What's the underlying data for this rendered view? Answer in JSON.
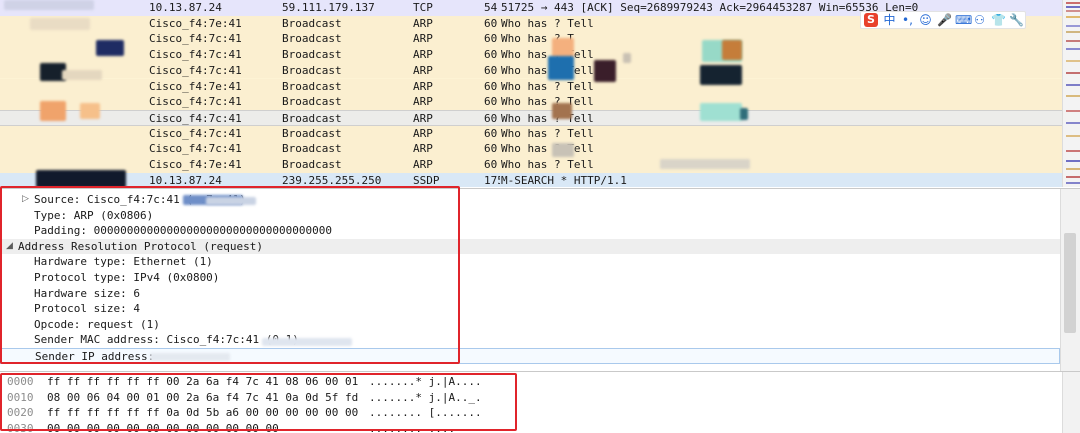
{
  "packets": [
    {
      "no": "",
      "source": "10.13.87.24",
      "destination": "59.111.179.137",
      "protocol": "TCP",
      "length": "54",
      "info": "51725 → 443 [ACK] Seq=2689979243 Ack=2964453287 Win=65536 Len=0",
      "kind": "tcp"
    },
    {
      "no": "",
      "source": "Cisco_f4:7e:41",
      "destination": "Broadcast",
      "protocol": "ARP",
      "length": "60",
      "info": "Who has            ? Tell",
      "kind": "arp"
    },
    {
      "no": "",
      "source": "Cisco_f4:7c:41",
      "destination": "Broadcast",
      "protocol": "ARP",
      "length": "60",
      "info": "Who has            ? T",
      "kind": "arp"
    },
    {
      "no": "",
      "source": "Cisco_f4:7c:41",
      "destination": "Broadcast",
      "protocol": "ARP",
      "length": "60",
      "info": "Who has            ? Tell",
      "kind": "arp"
    },
    {
      "no": "",
      "source": "Cisco_f4:7c:41",
      "destination": "Broadcast",
      "protocol": "ARP",
      "length": "60",
      "info": "Who has            ? Tell",
      "kind": "arp"
    },
    {
      "no": "",
      "source": "Cisco_f4:7e:41",
      "destination": "Broadcast",
      "protocol": "ARP",
      "length": "60",
      "info": "Who has            ? Tell",
      "kind": "arp"
    },
    {
      "no": "",
      "source": "Cisco_f4:7c:41",
      "destination": "Broadcast",
      "protocol": "ARP",
      "length": "60",
      "info": "Who has            ? Tell",
      "kind": "arp"
    },
    {
      "no": "",
      "source": "Cisco_f4:7c:41",
      "destination": "Broadcast",
      "protocol": "ARP",
      "length": "60",
      "info": "Who has            ? Tell",
      "kind": "selected"
    },
    {
      "no": "",
      "source": "Cisco_f4:7c:41",
      "destination": "Broadcast",
      "protocol": "ARP",
      "length": "60",
      "info": "Who has            ? Tell",
      "kind": "arp"
    },
    {
      "no": "",
      "source": "Cisco_f4:7c:41",
      "destination": "Broadcast",
      "protocol": "ARP",
      "length": "60",
      "info": "Who has            ? Tell",
      "kind": "arp"
    },
    {
      "no": "",
      "source": "Cisco_f4:7e:41",
      "destination": "Broadcast",
      "protocol": "ARP",
      "length": "60",
      "info": "Who has            ? Tell",
      "kind": "arp"
    },
    {
      "no": "",
      "source": "10.13.87.24",
      "destination": "239.255.255.250",
      "protocol": "SSDP",
      "length": "175",
      "info": "M-SEARCH * HTTP/1.1",
      "kind": "ssdp"
    }
  ],
  "details": [
    {
      "text": "Source: Cisco_f4:7c:41 (         .7c:41)",
      "indent": 1,
      "arrow": "▷",
      "kind": "field"
    },
    {
      "text": "Type: ARP (0x0806)",
      "indent": 2,
      "arrow": "",
      "kind": "field"
    },
    {
      "text": "Padding: 000000000000000000000000000000000000",
      "indent": 2,
      "arrow": "",
      "kind": "field"
    },
    {
      "text": "Address Resolution Protocol (request)",
      "indent": 0,
      "arrow": "◢",
      "kind": "section"
    },
    {
      "text": "Hardware type: Ethernet (1)",
      "indent": 2,
      "arrow": "",
      "kind": "field"
    },
    {
      "text": "Protocol type: IPv4 (0x0800)",
      "indent": 2,
      "arrow": "",
      "kind": "field"
    },
    {
      "text": "Hardware size: 6",
      "indent": 2,
      "arrow": "",
      "kind": "field"
    },
    {
      "text": "Protocol size: 4",
      "indent": 2,
      "arrow": "",
      "kind": "field"
    },
    {
      "text": "Opcode: request (1)",
      "indent": 2,
      "arrow": "",
      "kind": "field"
    },
    {
      "text": "Sender MAC address: Cisco_f4:7c:41 (0              1)",
      "indent": 2,
      "arrow": "",
      "kind": "field"
    },
    {
      "text": "Sender IP address:",
      "indent": 2,
      "arrow": "",
      "kind": "field-selected"
    }
  ],
  "bytes": [
    {
      "offset": "0000",
      "hex": "ff ff ff ff ff ff 00 2a  6a f4 7c 41 08 06 00 01",
      "ascii": ".......* j.|A...."
    },
    {
      "offset": "0010",
      "hex": "08 00 06 04 00 01 00 2a  6a f4 7c 41 0a 0d 5f fd",
      "ascii": ".......* j.|A.._."
    },
    {
      "offset": "0020",
      "hex": "ff ff ff ff ff ff 0a 0d  5b a6 00 00 00 00 00 00",
      "ascii": "........ [......."
    },
    {
      "offset": "0030",
      "hex": "00 00 00 00 00 00 00 00  00 00 00 00",
      "ascii": "........ ...."
    }
  ],
  "ime_toolbar": {
    "logo": "S",
    "buttons": [
      {
        "label": "中",
        "icon": "chinese-input-icon"
      },
      {
        "label": "•,",
        "icon": "punctuation-icon"
      },
      {
        "label": "☺",
        "icon": "emoji-icon"
      },
      {
        "label": "🎤",
        "icon": "microphone-icon"
      },
      {
        "label": "⌨",
        "icon": "keyboard-icon"
      },
      {
        "label": "⚇",
        "icon": "user-icon"
      },
      {
        "label": "👕",
        "icon": "skin-icon"
      },
      {
        "label": "🔧",
        "icon": "wrench-icon"
      }
    ]
  },
  "colors": {
    "tcp_row": "#e6e5fb",
    "arp_row": "#fbefd0",
    "ssdp_row": "#d9e8f6",
    "selected_row": "#ececea",
    "annotation_red": "#e0242b"
  }
}
